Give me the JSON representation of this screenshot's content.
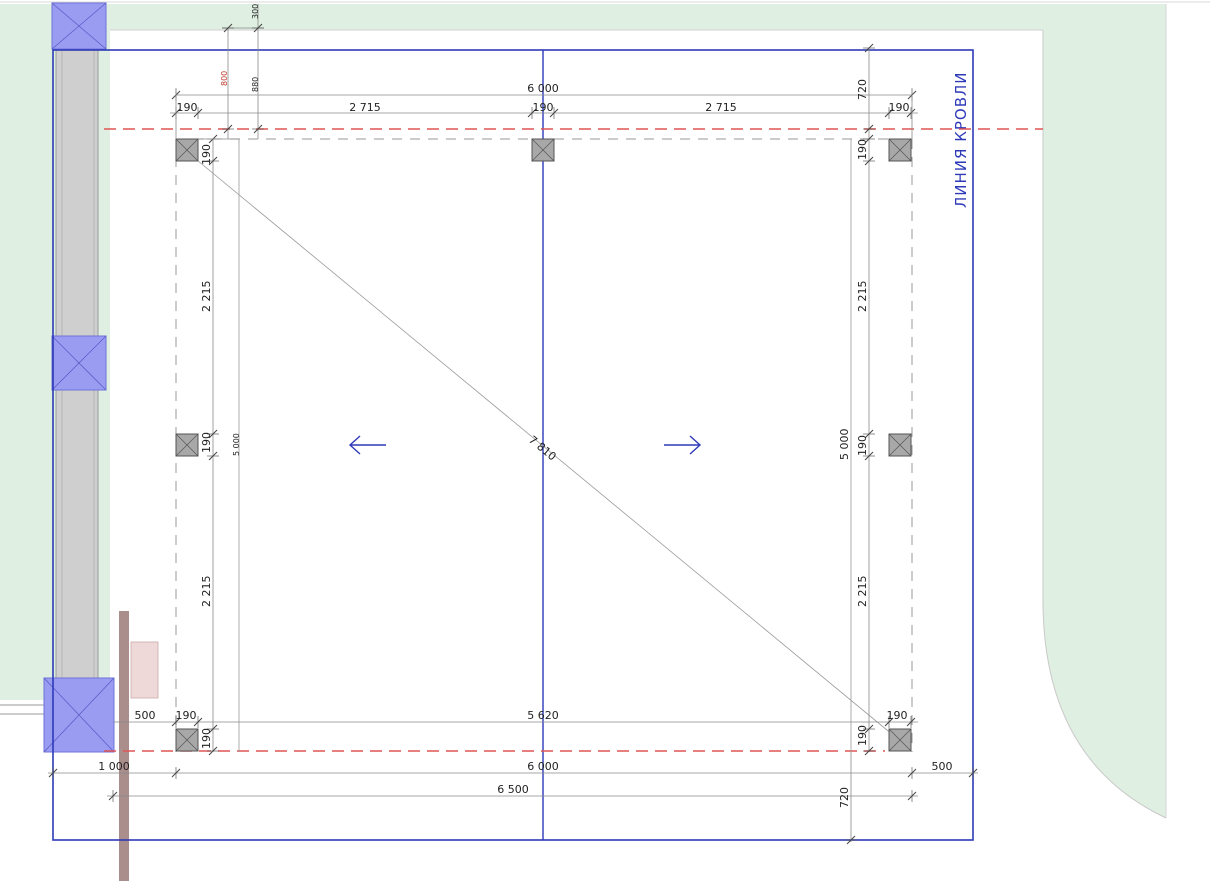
{
  "drawing": {
    "roof_line_label": "ЛИНИЯ КРОВЛИ",
    "diagonal_label": "7 810",
    "colors": {
      "lawn": "#dff0e2",
      "roof_outline": "#2e3ab8",
      "red_dashed": "#e05555",
      "post_fill": "#a8a8a8",
      "blue_pier": "#9a9cf2",
      "wall": "#cfcfcf",
      "fence_post": "#a98e8c",
      "pink_block": "#efd8d8"
    },
    "top_dims": {
      "overall": "6 000",
      "seg_left_post": "190",
      "seg_left_span": "2 715",
      "seg_mid_post": "190",
      "seg_right_span": "2 715",
      "seg_right_post": "190",
      "top_small_300": "300",
      "top_small_880": "880",
      "top_red_800": "800",
      "right_720_top": "720"
    },
    "left_dims": {
      "post_top": "190",
      "span_top": "2 215",
      "post_mid": "190",
      "span_bottom": "2 215",
      "post_bottom": "190",
      "overall_small": "5 000"
    },
    "right_dims": {
      "post_top": "190",
      "span_top": "2 215",
      "post_mid": "190",
      "overall": "5 000",
      "span_bottom": "2 215",
      "post_bottom": "190",
      "right_720_bottom": "720"
    },
    "bottom_dims": {
      "left_500": "500",
      "left_post": "190",
      "inner_span": "5 620",
      "right_post": "190",
      "left_1000": "1 000",
      "overall_6000": "6 000",
      "right_500": "500",
      "overall_6500": "6 500"
    }
  }
}
